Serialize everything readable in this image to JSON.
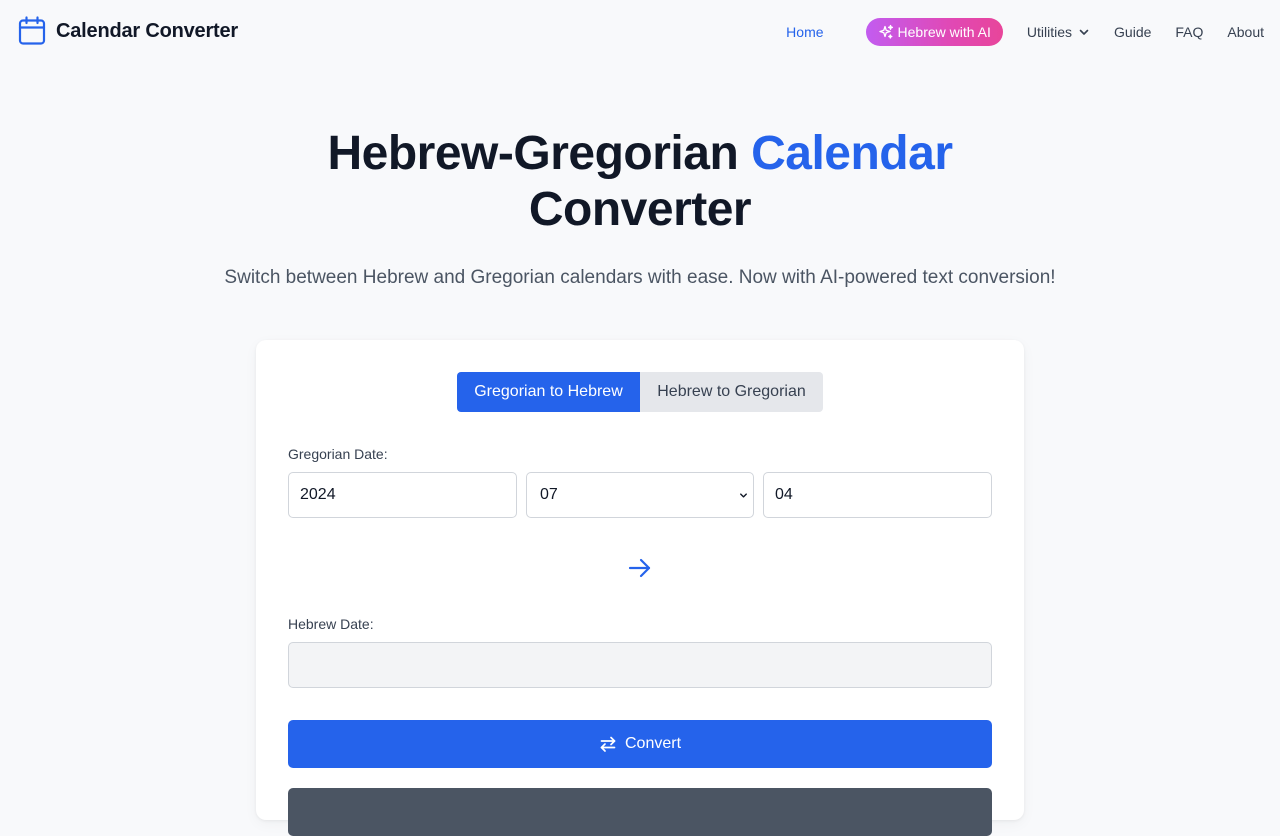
{
  "nav": {
    "brand": "Calendar Converter",
    "brand_icon": "calendar-icon",
    "links": {
      "home": "Home",
      "ai": "Hebrew with AI",
      "utilities": "Utilities",
      "guide": "Guide",
      "faq": "FAQ",
      "about": "About"
    },
    "active": "Home"
  },
  "hero": {
    "title_part1": "Hebrew-Gregorian ",
    "title_accent": "Calendar",
    "title_part2": "Converter",
    "subtitle": "Switch between Hebrew and Gregorian calendars with ease. Now with AI-powered text conversion!"
  },
  "converter": {
    "tabs": {
      "active": "Gregorian to Hebrew",
      "inactive": "Hebrew to Gregorian"
    },
    "gregorian_label": "Gregorian Date:",
    "year": "2024",
    "month": "07",
    "day": "04",
    "hebrew_label": "Hebrew Date:",
    "hebrew_value": "",
    "convert_label": "Convert"
  },
  "colors": {
    "accent": "#2563eb",
    "ai_gradient_start": "#c25cf0",
    "ai_gradient_end": "#e8459a",
    "dark_button": "#4b5563"
  }
}
